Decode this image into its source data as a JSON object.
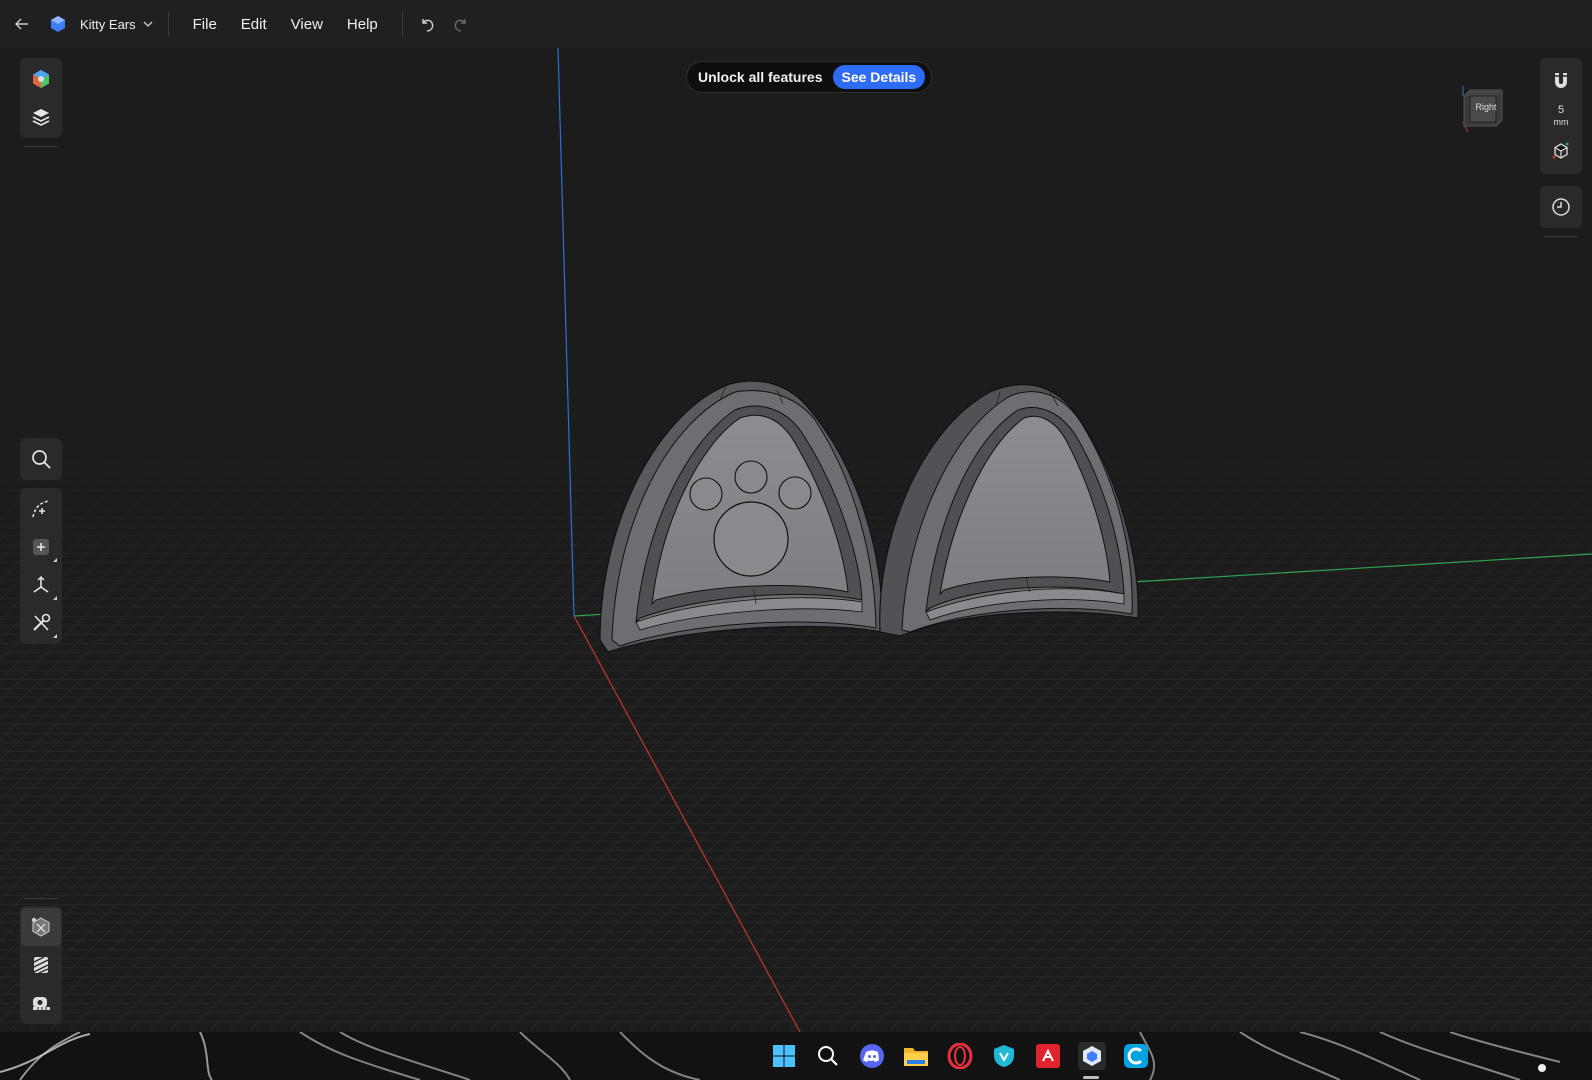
{
  "app": {
    "title": "Kitty Ears",
    "menus": [
      "File",
      "Edit",
      "View",
      "Help"
    ]
  },
  "banner": {
    "text": "Unlock all features",
    "button": "See Details"
  },
  "viewcube": {
    "face_label": "Right"
  },
  "snap": {
    "value": "5",
    "unit": "mm"
  },
  "icons": {
    "back": "back-arrow-icon",
    "app_logo": "shapr-logo-icon",
    "undo": "undo-icon",
    "redo": "redo-icon"
  },
  "colors": {
    "background": "#1c1c1c",
    "menubar": "#202020",
    "panel": "#2a2a2a",
    "accent": "#2e6cf6",
    "axis_x": "#c0392b",
    "axis_y": "#2ea44f",
    "axis_z": "#2f6fd6"
  }
}
